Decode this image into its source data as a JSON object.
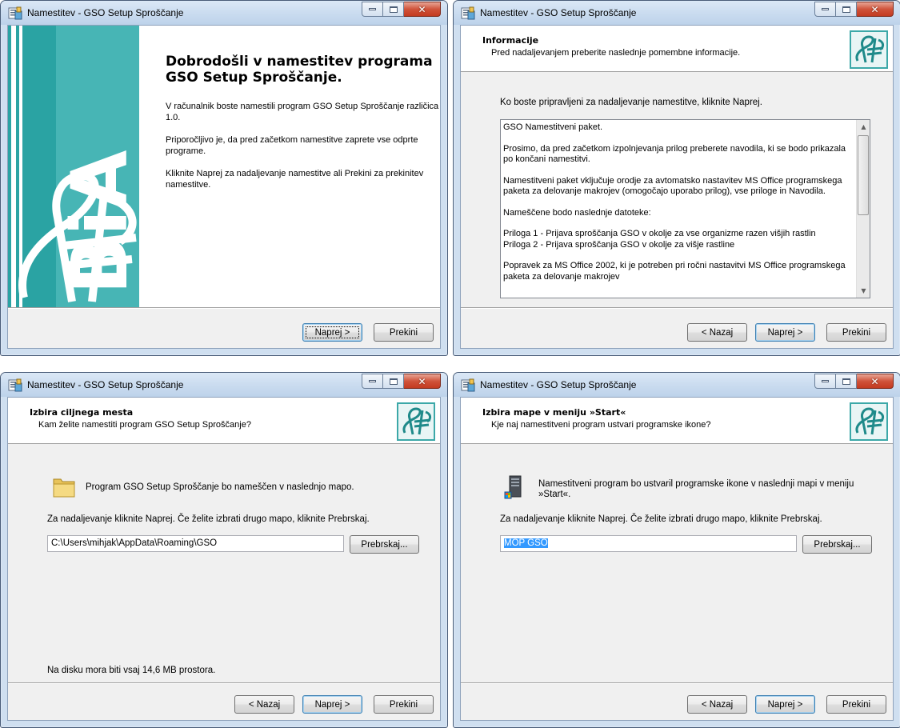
{
  "window_title": "Namestitev - GSO Setup Sproščanje",
  "buttons": {
    "back": "< Nazaj",
    "next": "Naprej >",
    "cancel": "Prekini",
    "browse": "Prebrskaj..."
  },
  "welcome": {
    "side_text": "BiA",
    "title": "Dobrodošli v namestitev programa GSO Setup Sproščanje.",
    "p1": "V računalnik boste namestili program GSO Setup Sproščanje različica 1.0.",
    "p2": "Priporočljivo je, da pred začetkom namestitve zaprete vse odprte programe.",
    "p3": "Kliknite Naprej za nadaljevanje namestitve ali Prekini za prekinitev namestitve."
  },
  "info": {
    "header_title": "Informacije",
    "header_sub": "Pred nadaljevanjem preberite naslednje pomembne informacije.",
    "instruction": "Ko boste pripravljeni za nadaljevanje namestitve, kliknite Naprej.",
    "memo": [
      "GSO Namestitveni paket.",
      "Prosimo, da pred začetkom izpolnjevanja prilog preberete navodila, ki se bodo prikazala po končani namestitvi.",
      "Namestitveni paket vključuje orodje za avtomatsko nastavitev MS Office programskega paketa za delovanje makrojev (omogočajo uporabo prilog), vse priloge in Navodila.",
      "Nameščene bodo naslednje datoteke:",
      "Priloga 1 - Prijava sproščanja GSO v okolje za vse organizme razen višjih rastlin\nPriloga 2 - Prijava sproščanja GSO v okolje za višje rastline",
      "Popravek za MS Office 2002, ki je potreben pri ročni nastavitvi MS Office programskega paketa za delovanje makrojev"
    ]
  },
  "dest": {
    "header_title": "Izbira ciljnega mesta",
    "header_sub": "Kam želite namestiti program GSO Setup Sproščanje?",
    "line1": "Program GSO Setup Sproščanje bo nameščen v naslednjo mapo.",
    "line2": "Za nadaljevanje kliknite Naprej. Če želite izbrati drugo mapo, kliknite Prebrskaj.",
    "path": "C:\\Users\\mihjak\\AppData\\Roaming\\GSO",
    "disk": "Na disku mora biti vsaj 14,6 MB prostora."
  },
  "start": {
    "header_title": "Izbira mape v meniju »Start«",
    "header_sub": "Kje naj namestitveni program ustvari programske ikone?",
    "line1": "Namestitveni program bo ustvaril programske ikone v naslednji mapi v meniju »Start«.",
    "line2": "Za nadaljevanje kliknite Naprej. Če želite izbrati drugo mapo, kliknite Prebrskaj.",
    "folder": "MOP GSO"
  }
}
